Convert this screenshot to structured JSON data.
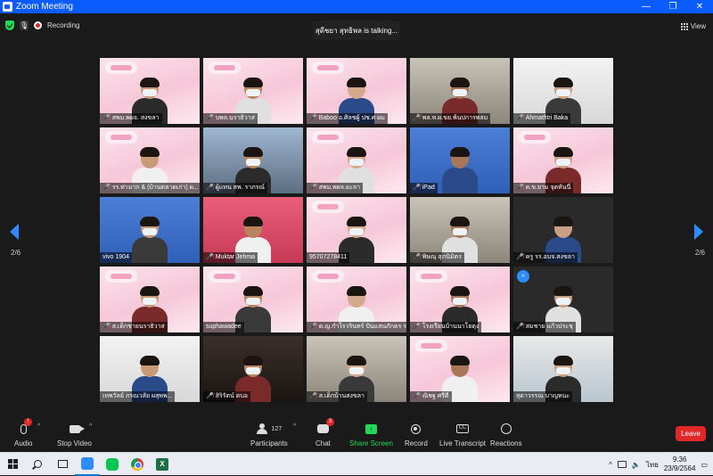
{
  "window": {
    "title": "Zoom Meeting",
    "controls": [
      "—",
      "❐",
      "✕"
    ]
  },
  "topbar": {
    "recording_label": "Recording",
    "talking_text": "สุดีชยา สุทธิพล is talking...",
    "view_label": "View"
  },
  "pagination": {
    "left": "2/6",
    "right": "2/6"
  },
  "tiles": [
    {
      "name": "สพม.พผจ. สงขลา",
      "muted": true,
      "bg": "pink"
    },
    {
      "name": "บพล.นราธิวาส",
      "muted": true,
      "bg": "pink"
    },
    {
      "name": "Baboo อ.ศิลชผู้ ปช.ศ ผม",
      "muted": true,
      "bg": "pink"
    },
    {
      "name": "พล.ท.ผ.ขย.พ้นปการพสม",
      "muted": true,
      "bg": "room"
    },
    {
      "name": "Ahmatfitri Baka",
      "muted": true,
      "bg": "white"
    },
    {
      "name": "รร.ท่ามาก & (บ้านตลาดเก่า) ผ...",
      "muted": true,
      "bg": "pink"
    },
    {
      "name": "ผู้แทน สพ. ราภรณ์",
      "muted": true,
      "bg": "sky"
    },
    {
      "name": "สพม.พผจ.ยะลา",
      "muted": true,
      "bg": "pink"
    },
    {
      "name": "iPad",
      "muted": true,
      "bg": "blue"
    },
    {
      "name": "ด.ข.ยาม จุดหันนี่",
      "muted": true,
      "bg": "pink"
    },
    {
      "name": "vivo 1904",
      "muted": false,
      "bg": "blue"
    },
    {
      "name": "Muktar Jehma",
      "muted": true,
      "bg": "red"
    },
    {
      "name": "95707278411",
      "muted": false,
      "bg": "pink"
    },
    {
      "name": "พิษณุ สุภนิมิตร",
      "muted": true,
      "bg": "room"
    },
    {
      "name": "ครู รร.อบจ.สงขลา",
      "muted": true,
      "bg": "black"
    },
    {
      "name": "ส.เด็กชายนราธิวาส",
      "muted": true,
      "bg": "pink"
    },
    {
      "name": "suphawadee",
      "muted": false,
      "bg": "pink"
    },
    {
      "name": "ด.ญ.กำไรวรินทร์ ปันแสนภักดร รร...",
      "muted": true,
      "bg": "pink"
    },
    {
      "name": "โรงเรียนบ้านนาโยตุง",
      "muted": true,
      "bg": "pink"
    },
    {
      "name": "สมชาย แก้วประชุ",
      "muted": true,
      "bg": "black",
      "activity": true
    },
    {
      "name": "เทพวัลย์ ภรณวลัย ผสุพพ...",
      "muted": false,
      "bg": "white"
    },
    {
      "name": "สิริรัตน์ ตบอ",
      "muted": true,
      "bg": "dark"
    },
    {
      "name": "ส.เด็กบ้านสงขลา",
      "muted": true,
      "bg": "room"
    },
    {
      "name": "ณิชฐ ศรีดี",
      "muted": true,
      "bg": "pink"
    },
    {
      "name": "สุดาวรรณ บาญหนะ",
      "muted": false,
      "bg": "school"
    }
  ],
  "toolbar": {
    "audio": "Audio",
    "audio_badge": "!",
    "stop_video": "Stop Video",
    "participants": "Participants",
    "participants_count": "127",
    "chat": "Chat",
    "chat_badge": "3",
    "share_screen": "Share Screen",
    "record": "Record",
    "live_transcript": "Live Transcript",
    "reactions": "Reactions",
    "leave": "Leave"
  },
  "taskbar": {
    "time": "9:36",
    "date": "23/9/2564",
    "lang": "ไทย"
  }
}
